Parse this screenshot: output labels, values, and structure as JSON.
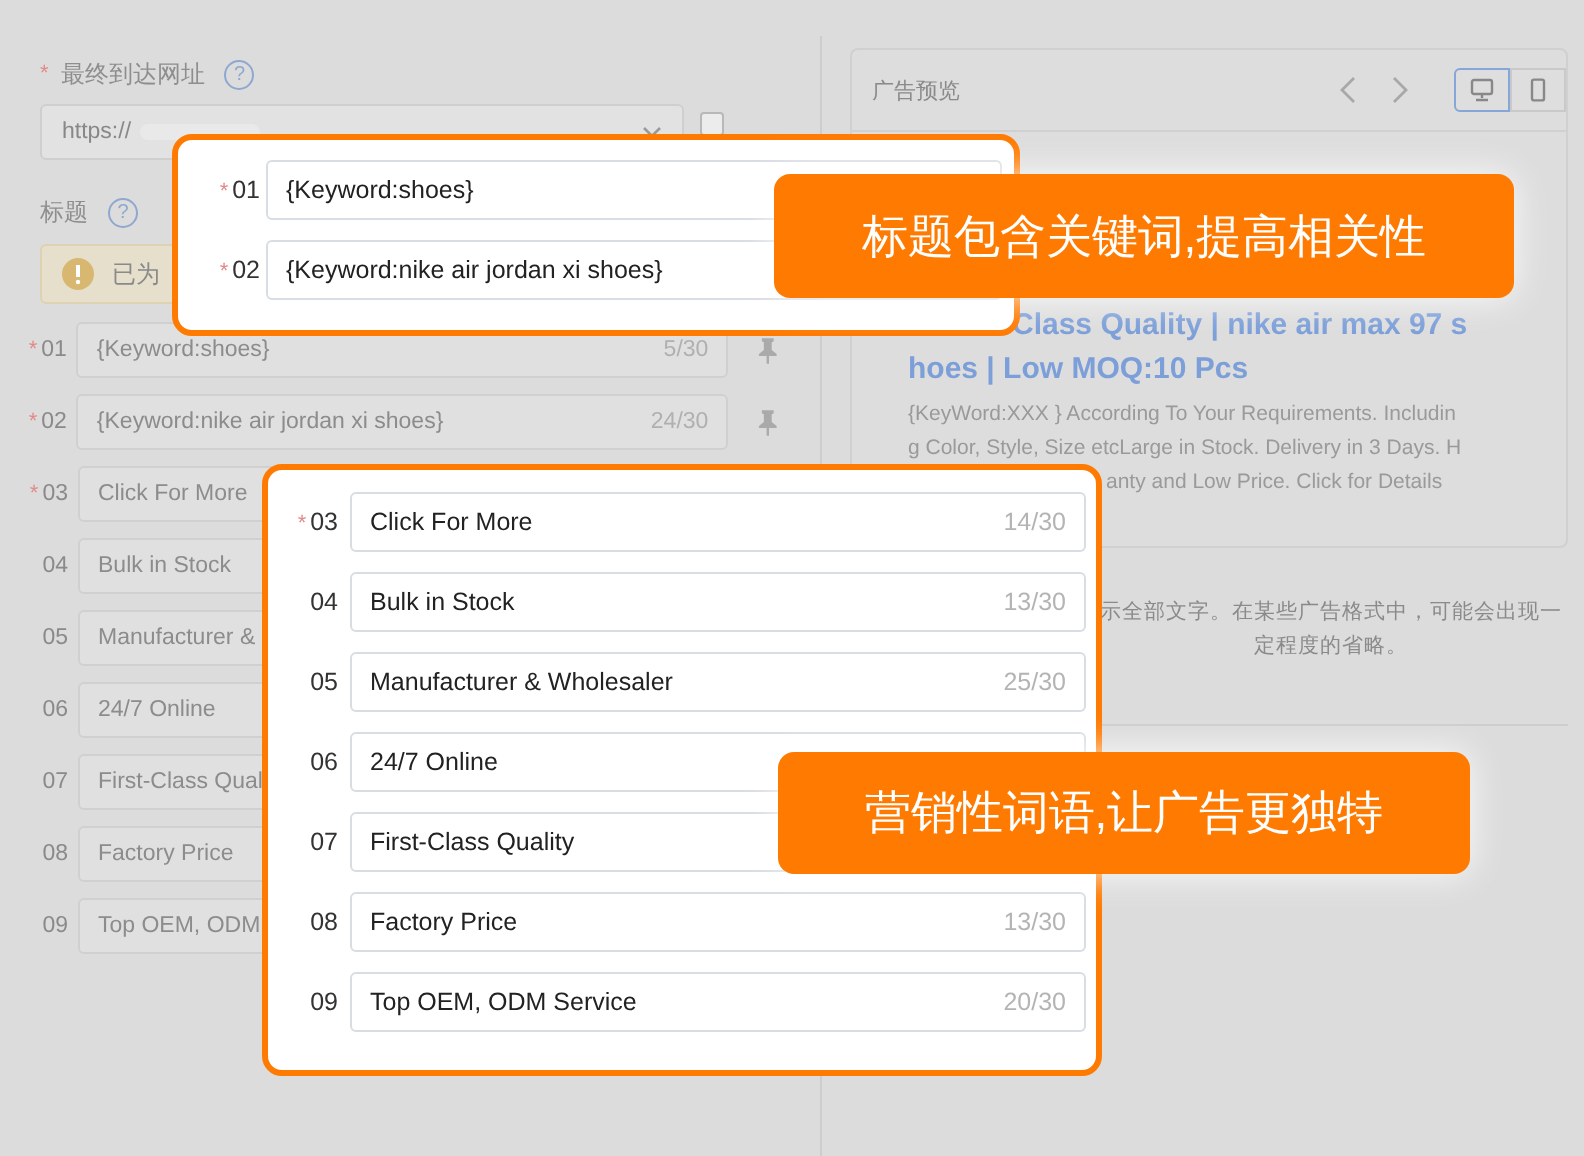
{
  "form": {
    "required_mark": "*",
    "url_label": "最终到达网址",
    "url_required": true,
    "help_icon": "?",
    "url_value": "https://",
    "custom_checkbox": {
      "checked": false
    },
    "title_label": "标题",
    "alert": "已为",
    "headlines": [
      {
        "index": "01",
        "required": true,
        "text": "{Keyword:shoes}",
        "count": "5/30"
      },
      {
        "index": "02",
        "required": true,
        "text": "{Keyword:nike air jordan xi shoes}",
        "count": "24/30"
      },
      {
        "index": "03",
        "required": true,
        "text": "Click For More"
      },
      {
        "index": "04",
        "required": false,
        "text": "Bulk in Stock"
      },
      {
        "index": "05",
        "required": false,
        "text": "Manufacturer &"
      },
      {
        "index": "06",
        "required": false,
        "text": "24/7 Online"
      },
      {
        "index": "07",
        "required": false,
        "text": "First-Class Qual"
      },
      {
        "index": "08",
        "required": false,
        "text": "Factory Price"
      },
      {
        "index": "09",
        "required": false,
        "text": "Top OEM, ODM"
      }
    ]
  },
  "preview": {
    "title": "广告预览",
    "devices": [
      {
        "kind": "desktop",
        "selected": true
      },
      {
        "kind": "mobile",
        "selected": false
      }
    ],
    "ad_title_lines": [
      "Class Quality | nike air max 97 s",
      "hoes | Low MOQ:10 Pcs"
    ],
    "ad_description_lines": [
      "{KeyWord:XXX } According To Your Requirements. Includin",
      "g Color, Style, Size etcLarge in Stock. Delivery in 3 Days. H",
      "anty and Low Price. Click for Details"
    ],
    "note": "示全部文字。在某些广告格式中，可能会出现一定程度的省略。"
  },
  "keyword_highlight": {
    "callout": "标题包含关键词,提高相关性",
    "headlines": [
      {
        "index": "01",
        "required": true,
        "text": "{Keyword:shoes}"
      },
      {
        "index": "02",
        "required": true,
        "text": "{Keyword:nike air jordan xi shoes}"
      }
    ]
  },
  "marketing_highlight": {
    "callout": "营销性词语,让广告更独特",
    "headlines": [
      {
        "index": "03",
        "required": true,
        "text": "Click For More",
        "count": "14/30"
      },
      {
        "index": "04",
        "required": false,
        "text": "Bulk in Stock",
        "count": "13/30"
      },
      {
        "index": "05",
        "required": false,
        "text": "Manufacturer & Wholesaler",
        "count": "25/30"
      },
      {
        "index": "06",
        "required": false,
        "text": "24/7 Online"
      },
      {
        "index": "07",
        "required": false,
        "text": "First-Class Quality"
      },
      {
        "index": "08",
        "required": false,
        "text": "Factory Price",
        "count": "13/30"
      },
      {
        "index": "09",
        "required": false,
        "text": "Top OEM, ODM Service",
        "count": "20/30"
      }
    ]
  }
}
